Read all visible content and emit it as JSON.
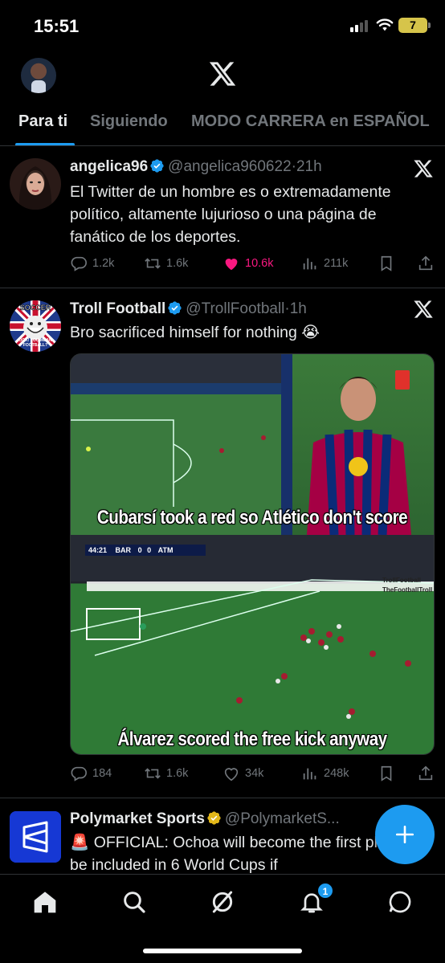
{
  "status_bar": {
    "time": "15:51",
    "battery": "7"
  },
  "tabs": [
    {
      "label": "Para ti",
      "active": true
    },
    {
      "label": "Siguiendo",
      "active": false
    },
    {
      "label": "MODO CARRERA en ESPAÑOL",
      "active": false
    }
  ],
  "posts": [
    {
      "name": "angelica96",
      "verified": "blue",
      "handle": "@angelica960622",
      "time": "21h",
      "text": "El Twitter de un hombre es o extremadamente político, altamente lujurioso o una página de fanático de los deportes.",
      "replies": "1.2k",
      "reposts": "1.6k",
      "likes": "10.6k",
      "views": "211k",
      "liked": true
    },
    {
      "name": "Troll Football",
      "verified": "blue",
      "handle": "@TrollFootball",
      "time": "1h",
      "text": "Bro sacrificed himself for nothing 😭",
      "replies": "184",
      "reposts": "1.6k",
      "likes": "34k",
      "views": "248k",
      "liked": false,
      "avatar_text": {
        "top": "SOCCER",
        "bottom": "OOK! YOU MEAN FOOTBALL?"
      },
      "media": {
        "caption_top": "Cubarsí took a red so Atlético don't score",
        "caption_bottom": "Álvarez scored the free kick anyway",
        "scoreboard": {
          "time": "44:21",
          "home": "BAR",
          "home_score": "0",
          "away_score": "0",
          "away": "ATM"
        },
        "watermark_1": "TrollFootball",
        "watermark_2": "TheFootballTroll"
      }
    },
    {
      "name": "Polymarket Sports",
      "verified": "gold",
      "handle": "@PolymarketS...",
      "text": "🚨 OFFICIAL: Ochoa will become the first player to be included in 6 World Cups if"
    }
  ],
  "nav": {
    "notification_count": "1"
  },
  "colors": {
    "accent": "#1d9bf0",
    "like": "#f91880",
    "muted": "#71767b",
    "gold": "#e2b719"
  }
}
